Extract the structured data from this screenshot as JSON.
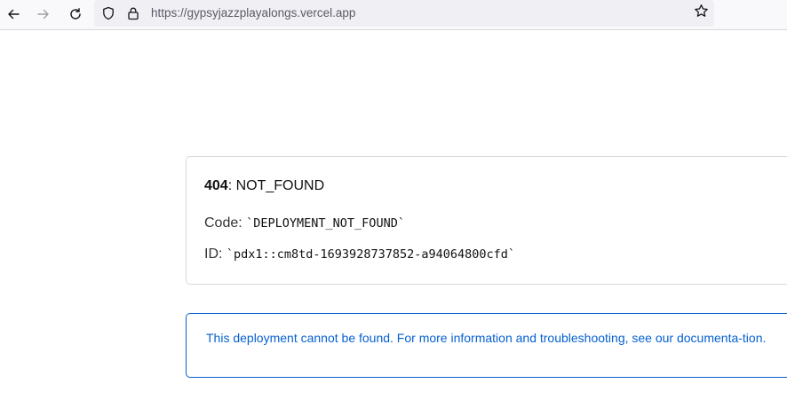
{
  "browser": {
    "url": "https://gypsyjazzplayalongs.vercel.app",
    "back_icon": "arrow-left-icon",
    "forward_icon": "arrow-right-icon",
    "reload_icon": "reload-icon",
    "shield_icon": "shield-icon",
    "lock_icon": "lock-icon",
    "star_icon": "star-icon"
  },
  "error": {
    "status": "404",
    "status_text": ": NOT_FOUND",
    "code_label": "Code: ",
    "code_value": "`DEPLOYMENT_NOT_FOUND`",
    "id_label": "ID: ",
    "id_value": "`pdx1::cm8td-1693928737852-a94064800cfd`"
  },
  "info": {
    "message": "This deployment cannot be found. For more information and troubleshooting, see our documenta-tion.",
    "accent_color": "#0761d1"
  }
}
